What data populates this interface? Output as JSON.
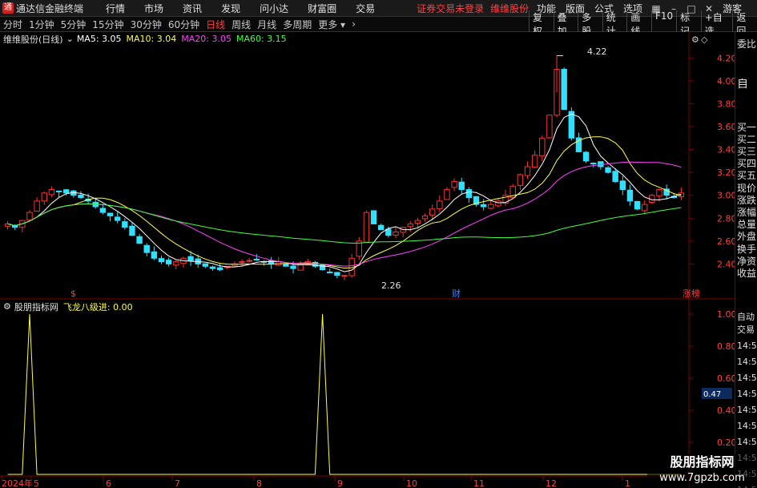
{
  "titlebar": {
    "app_title": "通达信金融终端",
    "menu": [
      "行情",
      "市场",
      "资讯",
      "发现",
      "问小达",
      "财富圈",
      "交易"
    ],
    "login_status": "证券交易未登录",
    "stock_name": "维维股份",
    "right_menu": [
      "功能",
      "版面",
      "公式",
      "选项"
    ],
    "guest": "游客"
  },
  "toolbar": {
    "periods": [
      "分时",
      "1分钟",
      "5分钟",
      "15分钟",
      "30分钟",
      "60分钟",
      "日线",
      "周线",
      "月线",
      "多周期",
      "更多"
    ],
    "active_period": "日线",
    "buttons": [
      "复权",
      "叠加",
      "多股",
      "统计",
      "画线",
      "F10",
      "标记",
      "+自选",
      "返回"
    ]
  },
  "main_chart": {
    "title": "维维股份(日线)",
    "ma": [
      {
        "label": "MA5: 3.05",
        "color": "#ffffff"
      },
      {
        "label": "MA10: 3.04",
        "color": "#ffff40"
      },
      {
        "label": "MA20: 3.05",
        "color": "#ff40ff"
      },
      {
        "label": "MA60: 3.15",
        "color": "#40ff40"
      }
    ],
    "y_ticks": [
      "4.20",
      "4.00",
      "3.80",
      "3.60",
      "3.40",
      "3.20",
      "3.00",
      "2.80",
      "2.60",
      "2.40"
    ],
    "high_label": "4.22",
    "low_label": "2.26",
    "markers": [
      {
        "text": "$",
        "color": "#ff4040"
      },
      {
        "text": "财",
        "color": "#4080ff"
      },
      {
        "text": "涨榜",
        "color": "#ff4040"
      }
    ]
  },
  "indicator": {
    "title": "股朋指标网",
    "name": "飞龙八级进: 0.00",
    "y_ticks": [
      "1.00",
      "0.80",
      "0.60",
      "0.40",
      "0.20"
    ],
    "current_value": "0.47"
  },
  "x_axis": {
    "labels": [
      "2024年",
      "5",
      "6",
      "7",
      "8",
      "9",
      "10",
      "11",
      "12",
      "1"
    ]
  },
  "right_panel": {
    "items": [
      "委比",
      "",
      "自",
      "",
      "买一",
      "买二",
      "买三",
      "买四",
      "买五",
      "现价",
      "涨跌",
      "涨幅",
      "总量",
      "外盘",
      "换手",
      "净资",
      "收益",
      "自动",
      "交易",
      "14:56",
      "14:56",
      "14:56",
      "14:56",
      "14:56",
      "14:56",
      "14:56",
      "14:56",
      "14:56",
      "14:56",
      "14:56"
    ]
  },
  "watermark": {
    "line1": "股朋指标网",
    "line2": "www.7gpzb.com"
  },
  "chart_data": {
    "type": "candlestick",
    "title": "维维股份(日线)",
    "ylim": [
      2.2,
      4.3
    ],
    "x_labels": [
      "5",
      "6",
      "7",
      "8",
      "9",
      "10",
      "11",
      "12",
      "1"
    ],
    "close_values": [
      2.75,
      2.72,
      2.78,
      2.85,
      2.95,
      3.02,
      3.05,
      3.03,
      3.02,
      3.0,
      2.98,
      2.95,
      2.9,
      2.85,
      2.82,
      2.78,
      2.72,
      2.65,
      2.58,
      2.5,
      2.45,
      2.42,
      2.4,
      2.42,
      2.45,
      2.43,
      2.4,
      2.38,
      2.36,
      2.35,
      2.38,
      2.4,
      2.42,
      2.43,
      2.44,
      2.42,
      2.4,
      2.42,
      2.38,
      2.36,
      2.4,
      2.42,
      2.38,
      2.35,
      2.33,
      2.3,
      2.3,
      2.45,
      2.6,
      2.85,
      2.75,
      2.7,
      2.65,
      2.68,
      2.72,
      2.75,
      2.78,
      2.82,
      2.88,
      2.95,
      3.05,
      3.12,
      3.05,
      2.98,
      2.92,
      2.9,
      2.92,
      2.95,
      3.0,
      3.08,
      3.18,
      3.25,
      3.35,
      3.5,
      3.7,
      4.1,
      3.75,
      3.5,
      3.38,
      3.3,
      3.28,
      3.25,
      3.2,
      3.12,
      3.05,
      2.95,
      2.88,
      2.92,
      3.0,
      3.05,
      3.0,
      2.98,
      3.02
    ],
    "indicator_values": [
      0,
      0,
      0,
      1,
      0,
      0,
      0,
      0,
      0,
      0,
      0,
      0,
      0,
      0,
      0,
      0,
      0,
      0,
      0,
      0,
      0,
      0,
      0,
      0,
      0,
      0,
      0,
      0,
      0,
      0,
      0,
      0,
      0,
      0,
      0,
      0,
      0,
      0,
      0,
      0,
      0,
      0,
      0,
      1,
      0,
      0,
      0,
      0,
      0,
      0,
      0,
      0,
      0,
      0,
      0,
      0,
      0,
      0,
      0,
      0,
      0,
      0,
      0,
      0,
      0,
      0,
      0,
      0,
      0,
      0,
      0,
      0,
      0,
      0,
      0,
      0,
      0,
      0,
      0,
      0,
      0,
      0,
      0,
      0,
      0,
      0,
      0,
      0,
      0,
      0,
      0,
      0,
      0
    ]
  }
}
